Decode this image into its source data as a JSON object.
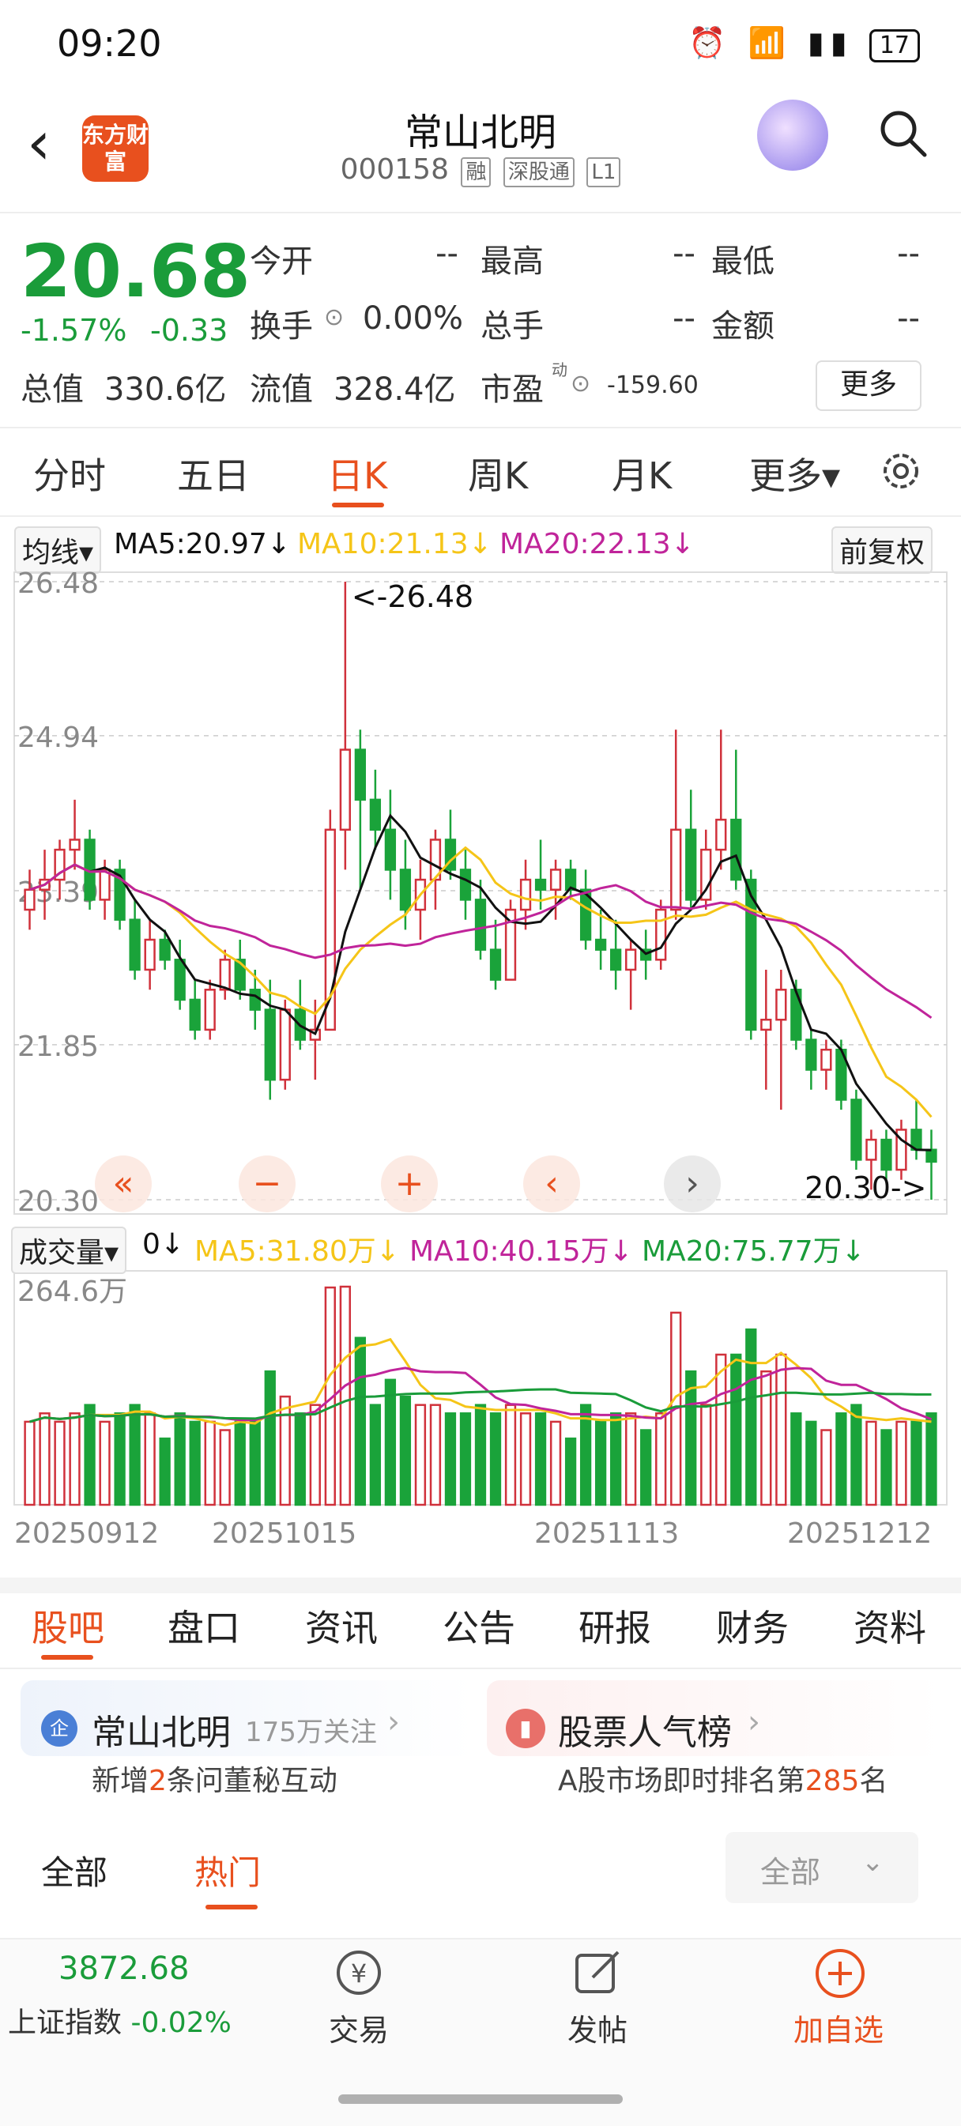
{
  "status_bar": {
    "time": "09:20",
    "battery": "17"
  },
  "header": {
    "title": "常山北明",
    "code": "000158",
    "tags": [
      "融",
      "深股通",
      "L1"
    ],
    "logo_text": "东方财富"
  },
  "quote": {
    "price": "20.68",
    "change_pct": "-1.57%",
    "change_abs": "-0.33",
    "open_label": "今开",
    "open_value": "--",
    "high_label": "最高",
    "high_value": "--",
    "low_label": "最低",
    "low_value": "--",
    "turnover_label": "换手",
    "turnover_value": "0.00%",
    "volume_label": "总手",
    "volume_value": "--",
    "amount_label": "金额",
    "amount_value": "--",
    "mktcap_label": "总值",
    "mktcap_value": "330.6亿",
    "float_label": "流值",
    "float_value": "328.4亿",
    "pe_label": "市盈",
    "pe_sup": "动",
    "pe_value": "-159.60",
    "more_label": "更多"
  },
  "period_tabs": [
    "分时",
    "五日",
    "日K",
    "周K",
    "月K",
    "更多▾"
  ],
  "period_active": "日K",
  "ma": {
    "selector": "均线",
    "ma5": "MA5:20.97↓",
    "ma10": "MA10:21.13↓",
    "ma20": "MA20:22.13↓",
    "adjust": "前复权",
    "colors": {
      "ma5": "#111111",
      "ma10": "#f5c518",
      "ma20": "#c0249a"
    }
  },
  "chart_data": {
    "type": "candlestick",
    "y_ticks": [
      "26.48",
      "24.94",
      "23.39",
      "21.85",
      "20.30"
    ],
    "ylim": [
      20.3,
      26.48
    ],
    "max_marker": "<-26.48",
    "min_marker": "20.30->",
    "candles": [
      [
        23.2,
        23.6,
        23.0,
        23.4
      ],
      [
        23.4,
        23.8,
        23.1,
        23.5
      ],
      [
        23.5,
        23.9,
        23.3,
        23.8
      ],
      [
        23.8,
        24.3,
        23.6,
        23.9
      ],
      [
        23.9,
        24.0,
        23.2,
        23.3
      ],
      [
        23.3,
        23.7,
        23.1,
        23.6
      ],
      [
        23.6,
        23.7,
        23.0,
        23.1
      ],
      [
        23.1,
        23.3,
        22.5,
        22.6
      ],
      [
        22.6,
        23.1,
        22.4,
        22.9
      ],
      [
        22.9,
        23.0,
        22.6,
        22.7
      ],
      [
        22.7,
        22.9,
        22.2,
        22.3
      ],
      [
        22.3,
        22.5,
        21.9,
        22.0
      ],
      [
        22.0,
        22.5,
        21.9,
        22.4
      ],
      [
        22.4,
        22.8,
        22.3,
        22.7
      ],
      [
        22.7,
        22.9,
        22.3,
        22.4
      ],
      [
        22.4,
        22.6,
        22.0,
        22.2
      ],
      [
        22.2,
        22.5,
        21.3,
        21.5
      ],
      [
        21.5,
        22.3,
        21.4,
        22.2
      ],
      [
        22.2,
        22.5,
        21.8,
        21.9
      ],
      [
        21.9,
        22.3,
        21.5,
        22.0
      ],
      [
        22.0,
        24.2,
        22.0,
        24.0
      ],
      [
        24.0,
        26.48,
        23.6,
        24.8
      ],
      [
        24.8,
        25.0,
        23.4,
        24.3
      ],
      [
        24.3,
        24.6,
        23.8,
        24.0
      ],
      [
        24.0,
        24.4,
        23.3,
        23.6
      ],
      [
        23.6,
        23.9,
        23.0,
        23.2
      ],
      [
        23.2,
        23.7,
        22.9,
        23.5
      ],
      [
        23.5,
        24.0,
        23.2,
        23.9
      ],
      [
        23.9,
        24.2,
        23.5,
        23.6
      ],
      [
        23.6,
        23.8,
        23.1,
        23.3
      ],
      [
        23.3,
        23.5,
        22.7,
        22.8
      ],
      [
        22.8,
        23.1,
        22.4,
        22.5
      ],
      [
        22.5,
        23.3,
        22.5,
        23.2
      ],
      [
        23.2,
        23.7,
        23.0,
        23.5
      ],
      [
        23.5,
        23.9,
        23.2,
        23.4
      ],
      [
        23.4,
        23.7,
        23.1,
        23.6
      ],
      [
        23.6,
        23.7,
        23.3,
        23.4
      ],
      [
        23.4,
        23.6,
        22.8,
        22.9
      ],
      [
        22.9,
        23.2,
        22.6,
        22.8
      ],
      [
        22.8,
        23.1,
        22.4,
        22.6
      ],
      [
        22.6,
        22.9,
        22.2,
        22.8
      ],
      [
        22.8,
        23.0,
        22.5,
        22.7
      ],
      [
        22.7,
        23.3,
        22.6,
        23.2
      ],
      [
        23.2,
        25.0,
        23.1,
        24.0
      ],
      [
        24.0,
        24.4,
        23.2,
        23.3
      ],
      [
        23.3,
        24.0,
        23.2,
        23.8
      ],
      [
        23.8,
        25.0,
        23.6,
        24.1
      ],
      [
        24.1,
        24.8,
        23.4,
        23.5
      ],
      [
        23.5,
        23.6,
        21.9,
        22.0
      ],
      [
        22.0,
        22.6,
        21.4,
        22.1
      ],
      [
        22.1,
        22.6,
        21.2,
        22.4
      ],
      [
        22.4,
        22.5,
        21.8,
        21.9
      ],
      [
        21.9,
        22.0,
        21.4,
        21.6
      ],
      [
        21.6,
        21.9,
        21.4,
        21.8
      ],
      [
        21.8,
        21.9,
        21.2,
        21.3
      ],
      [
        21.3,
        21.4,
        20.6,
        20.7
      ],
      [
        20.7,
        21.0,
        20.4,
        20.9
      ],
      [
        20.9,
        21.0,
        20.5,
        20.6
      ],
      [
        20.6,
        21.1,
        20.5,
        21.0
      ],
      [
        21.0,
        21.3,
        20.7,
        20.8
      ],
      [
        20.8,
        21.0,
        20.3,
        20.68
      ]
    ],
    "volume_label": "成交量",
    "volume_now": "0↓",
    "vol_ma5": "MA5:31.80万↓",
    "vol_ma10": "MA10:40.15万↓",
    "vol_ma20": "MA20:75.77万↓",
    "vol_max_label": "264.6万",
    "x_labels": [
      "20250912",
      "20251015",
      "20251113",
      "20251212"
    ]
  },
  "chart_controls": [
    "«",
    "−",
    "+",
    "‹",
    "›"
  ],
  "bottom_tabs": [
    "股吧",
    "盘口",
    "资讯",
    "公告",
    "研报",
    "财务",
    "资料"
  ],
  "bottom_tab_active": "股吧",
  "card_left": {
    "name": "常山北明",
    "follow": "175万关注",
    "sub_prefix": "新增",
    "sub_num": "2",
    "sub_suffix": "条问董秘互动",
    "icon": "企"
  },
  "card_right": {
    "title": "股票人气榜",
    "sub_prefix": "A股市场即时排名第",
    "sub_num": "285",
    "sub_suffix": "名"
  },
  "filter_tabs": [
    "全部",
    "热门"
  ],
  "filter_active": "热门",
  "filter_select": "全部",
  "bottom_nav": {
    "index_value": "3872.68",
    "index_name": "上证指数",
    "index_change": "-0.02%",
    "trade": "交易",
    "post": "发帖",
    "add": "加自选"
  }
}
